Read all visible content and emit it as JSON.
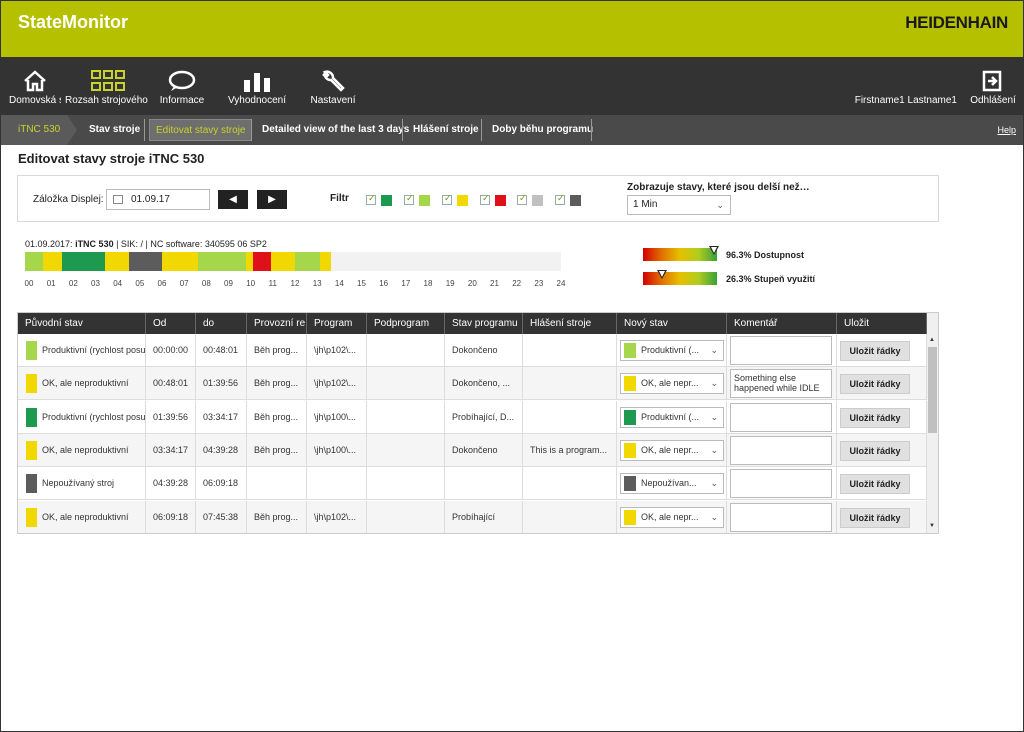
{
  "app": {
    "title": "StateMonitor",
    "logo": "HEIDENHAIN",
    "accent_color": "#b5c000"
  },
  "nav": {
    "items": [
      {
        "label": "Domovská s",
        "icon": "home-icon"
      },
      {
        "label": "Rozsah strojového p",
        "icon": "grid-icon"
      },
      {
        "label": "Informace",
        "icon": "chat-icon"
      },
      {
        "label": "Vyhodnocení",
        "icon": "bar-chart-icon"
      },
      {
        "label": "Nastavení",
        "icon": "wrench-icon"
      }
    ],
    "user": "Firstname1 Lastname1",
    "logout": "Odhlášení"
  },
  "breadcrumb": {
    "home": "iTNC 530",
    "tabs": [
      "Stav stroje",
      "Editovat stavy stroje",
      "Detailed view of the last 3 days",
      "Hlášení stroje",
      "Doby běhu programu"
    ],
    "active_tab": "Editovat stavy stroje",
    "help": "Help"
  },
  "page": {
    "title": "Editovat stavy stroje iTNC 530"
  },
  "filters": {
    "bookmark_label": "Záložka Displej:",
    "date": "01.09.17",
    "filter_label": "Filtr",
    "filter_colors": [
      "#1d9a50",
      "#a6d64a",
      "#f1d800",
      "#e0101a",
      "#c0c0c0",
      "#5c5c5c"
    ],
    "duration_label": "Zobrazuje stavy, které jsou delší než…",
    "duration_value": "1 Min"
  },
  "timeline": {
    "date": "01.09.2017:",
    "machine": "iTNC 530",
    "sik_label": "| SIK:",
    "sik_value": "/",
    "nc_label": "| NC software:",
    "nc_value": "340595 06 SP2",
    "hours": [
      "00",
      "01",
      "02",
      "03",
      "04",
      "05",
      "06",
      "07",
      "08",
      "09",
      "10",
      "11",
      "12",
      "13",
      "14",
      "15",
      "16",
      "17",
      "18",
      "19",
      "20",
      "21",
      "22",
      "23",
      "24"
    ],
    "segments": [
      {
        "start": 0.0,
        "end": 0.8,
        "color": "#a6d64a"
      },
      {
        "start": 0.8,
        "end": 1.66,
        "color": "#f1d800"
      },
      {
        "start": 1.66,
        "end": 3.57,
        "color": "#1d9a50"
      },
      {
        "start": 3.57,
        "end": 4.66,
        "color": "#f1d800"
      },
      {
        "start": 4.66,
        "end": 6.15,
        "color": "#5c5c5c"
      },
      {
        "start": 6.15,
        "end": 7.76,
        "color": "#f1d800"
      },
      {
        "start": 7.76,
        "end": 9.9,
        "color": "#a6d64a"
      },
      {
        "start": 9.9,
        "end": 10.2,
        "color": "#f1d800"
      },
      {
        "start": 10.2,
        "end": 11.0,
        "color": "#e0101a"
      },
      {
        "start": 11.0,
        "end": 12.1,
        "color": "#f1d800"
      },
      {
        "start": 12.1,
        "end": 13.2,
        "color": "#a6d64a"
      },
      {
        "start": 13.2,
        "end": 13.7,
        "color": "#f1d800"
      }
    ]
  },
  "kpis": [
    {
      "label": "96.3% Dostupnost",
      "value": 0.963
    },
    {
      "label": "26.3% Stupeň využití",
      "value": 0.263
    }
  ],
  "table": {
    "headers": [
      "Původní stav",
      "Od",
      "do",
      "Provozní re",
      "Program",
      "Podprogram",
      "Stav programu",
      "Hlášení stroje",
      "Nový stav",
      "Komentář",
      "Uložit"
    ],
    "save_label": "Uložit řádky",
    "rows": [
      {
        "color": "#a6d64a",
        "state": "Produktivní (rychlost posu",
        "from": "00:00:00",
        "to": "00:48:01",
        "mode": "Běh prog...",
        "program": "\\jh\\p102\\...",
        "sub": "",
        "prog_state": "Dokončeno",
        "message": "",
        "new_color": "#a6d64a",
        "new_state": "Produktivní (...",
        "comment": ""
      },
      {
        "color": "#f1d800",
        "state": "OK, ale neproduktivní",
        "from": "00:48:01",
        "to": "01:39:56",
        "mode": "Běh prog...",
        "program": "\\jh\\p102\\...",
        "sub": "",
        "prog_state": "Dokončeno, ...",
        "message": "",
        "new_color": "#f1d800",
        "new_state": "OK, ale nepr...",
        "comment": "Something else happened while IDLE"
      },
      {
        "color": "#1d9a50",
        "state": "Produktivní (rychlost posu",
        "from": "01:39:56",
        "to": "03:34:17",
        "mode": "Běh prog...",
        "program": "\\jh\\p100\\...",
        "sub": "",
        "prog_state": "Probíhající, D...",
        "message": "",
        "new_color": "#1d9a50",
        "new_state": "Produktivní (...",
        "comment": ""
      },
      {
        "color": "#f1d800",
        "state": "OK, ale neproduktivní",
        "from": "03:34:17",
        "to": "04:39:28",
        "mode": "Běh prog...",
        "program": "\\jh\\p100\\...",
        "sub": "",
        "prog_state": "Dokončeno",
        "message": "This is a program...",
        "new_color": "#f1d800",
        "new_state": "OK, ale nepr...",
        "comment": ""
      },
      {
        "color": "#5c5c5c",
        "state": "Nepoužívaný stroj",
        "from": "04:39:28",
        "to": "06:09:18",
        "mode": "",
        "program": "",
        "sub": "",
        "prog_state": "",
        "message": "",
        "new_color": "#5c5c5c",
        "new_state": "Nepoužívan...",
        "comment": ""
      },
      {
        "color": "#f1d800",
        "state": "OK, ale neproduktivní",
        "from": "06:09:18",
        "to": "07:45:38",
        "mode": "Běh prog...",
        "program": "\\jh\\p102\\...",
        "sub": "",
        "prog_state": "Probíhající",
        "message": "",
        "new_color": "#f1d800",
        "new_state": "OK, ale nepr...",
        "comment": ""
      }
    ]
  }
}
